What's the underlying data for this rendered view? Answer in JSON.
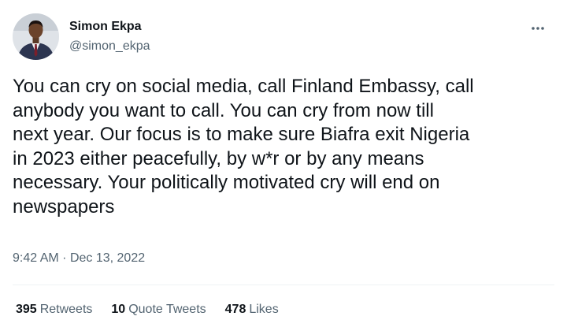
{
  "author": {
    "display_name": "Simon Ekpa",
    "handle": "@simon_ekpa"
  },
  "tweet": {
    "text": "You can cry on social media, call Finland Embassy, call\nanybody you want to call. You can cry from now till\nnext year. Our focus is to make sure Biafra exit Nigeria\nin 2023 either peacefully, by w*r or by any means\nnecessary. Your politically motivated cry will end on\nnewspapers",
    "time": "9:42 AM",
    "separator": "·",
    "date": "Dec 13, 2022"
  },
  "stats": [
    {
      "count": "395",
      "label": "Retweets"
    },
    {
      "count": "10",
      "label": "Quote Tweets"
    },
    {
      "count": "478",
      "label": "Likes"
    }
  ],
  "icons": {
    "more": "more-horizontal-icon"
  },
  "colors": {
    "text_primary": "#0f1419",
    "text_secondary": "#536471",
    "divider": "#eff3f4"
  }
}
